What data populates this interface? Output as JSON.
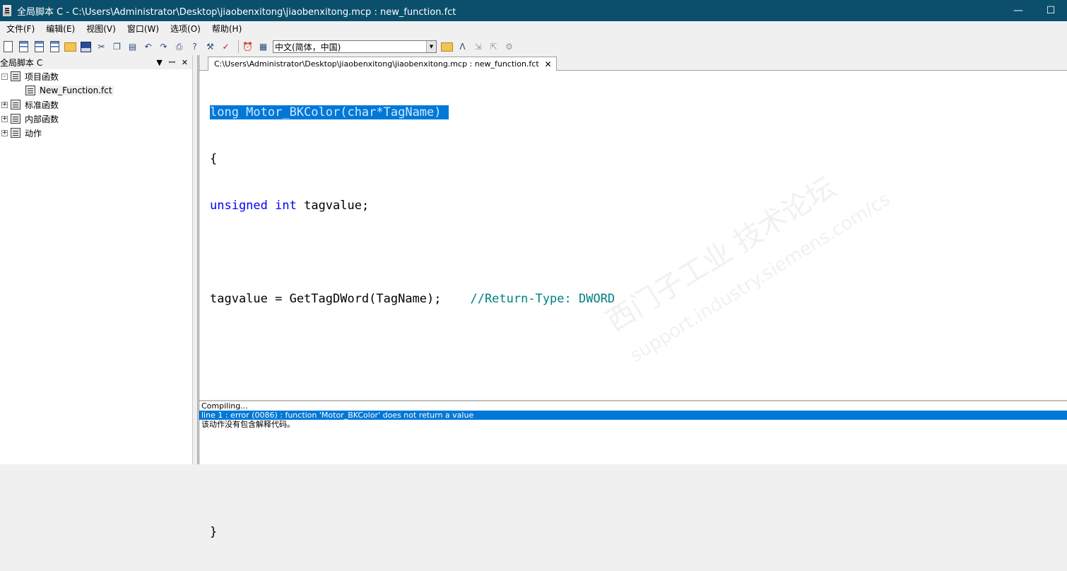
{
  "window": {
    "title": "全局脚本 C - C:\\Users\\Administrator\\Desktop\\jiaobenxitong\\jiaobenxitong.mcp : new_function.fct",
    "minimize": "—",
    "maximize": "☐"
  },
  "menu": [
    {
      "label": "文件(F)"
    },
    {
      "label": "编辑(E)"
    },
    {
      "label": "视图(V)"
    },
    {
      "label": "窗口(W)"
    },
    {
      "label": "选项(O)"
    },
    {
      "label": "帮助(H)"
    }
  ],
  "toolbar": {
    "language_select": "中文(简体，中国)"
  },
  "left_panel": {
    "title": "全局脚本 C",
    "dropdown_glyph": "▼",
    "pin_glyph": "ꟷ",
    "close_glyph": "✕",
    "tree": [
      {
        "label": "项目函数",
        "expander": "-",
        "children": [
          {
            "label": "New_Function.fct"
          }
        ]
      },
      {
        "label": "标准函数",
        "expander": "+"
      },
      {
        "label": "内部函数",
        "expander": "+"
      },
      {
        "label": "动作",
        "expander": "+"
      }
    ]
  },
  "editor": {
    "tab_label": "C:\\Users\\Administrator\\Desktop\\jiaobenxitong\\jiaobenxitong.mcp : new_function.fct",
    "tab_close": "✕",
    "code": {
      "line1": "long Motor_BKColor(char*TagName) ",
      "line2": "{",
      "line3_kw1": "unsigned",
      "line3_kw2": "int",
      "line3_rest": " tagvalue;",
      "line5_code": "tagvalue = GetTagDWord(TagName);    ",
      "line5_comment": "//Return-Type: DWORD",
      "line10": "}"
    },
    "watermark": "西门子工业  技术论坛",
    "watermark_url": "support.industry.siemens.com/cs"
  },
  "output": {
    "lines": [
      "Compiling...",
      "line 1 : error (0086) : function 'Motor_BKColor' does not return a value",
      "该动作没有包含解释代码。"
    ]
  }
}
